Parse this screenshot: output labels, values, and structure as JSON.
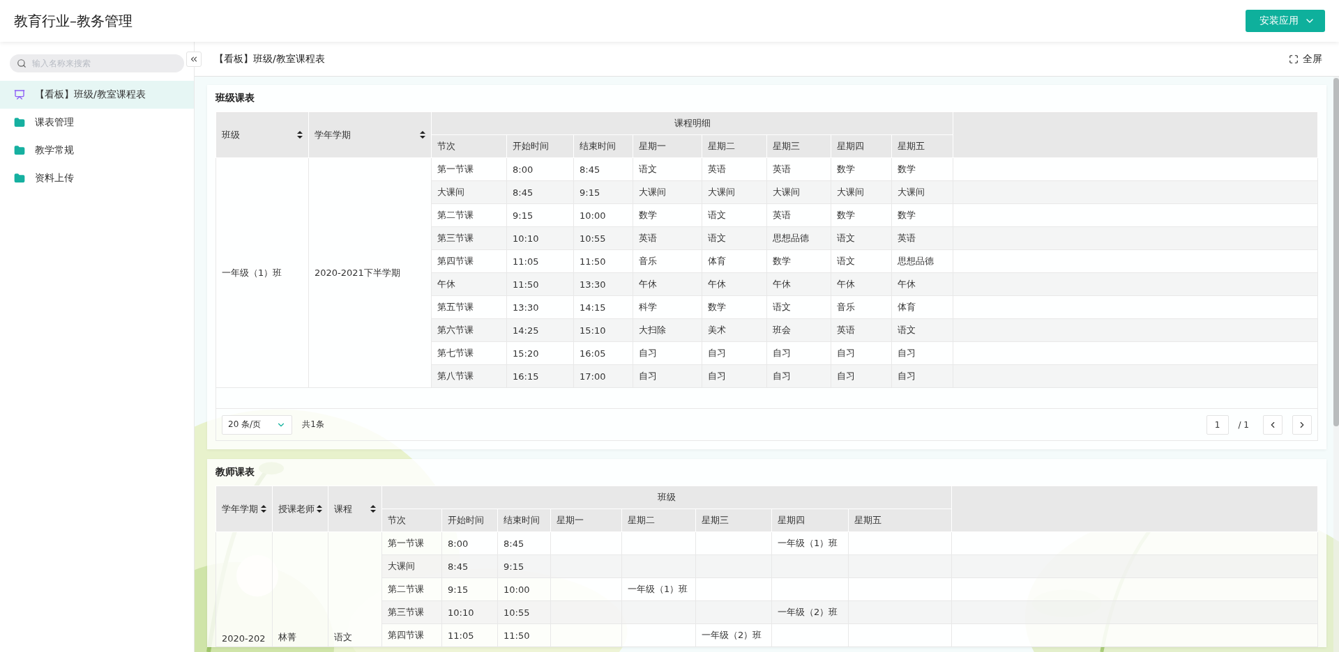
{
  "header": {
    "title": "教育行业–教务管理",
    "install_button": "安装应用"
  },
  "sidebar": {
    "search_placeholder": "输入名称来搜索",
    "items": [
      {
        "label": "【看板】班级/教室课程表",
        "kind": "board",
        "selected": true
      },
      {
        "label": "课表管理",
        "kind": "folder",
        "selected": false
      },
      {
        "label": "教学常规",
        "kind": "folder",
        "selected": false
      },
      {
        "label": "资料上传",
        "kind": "folder",
        "selected": false
      }
    ]
  },
  "breadcrumb": {
    "title": "【看板】班级/教室课程表",
    "fullscreen_button": "全屏"
  },
  "class_schedule": {
    "title": "班级课表",
    "lead_columns": [
      "班级",
      "学年学期"
    ],
    "group_title": "课程明细",
    "sub_columns": [
      "节次",
      "开始时间",
      "结束时间",
      "星期一",
      "星期二",
      "星期三",
      "星期四",
      "星期五"
    ],
    "lead_values": [
      "一年级（1）班",
      "2020-2021下半学期"
    ],
    "rows": [
      [
        "第一节课",
        "8:00",
        "8:45",
        "语文",
        "英语",
        "英语",
        "数学",
        "数学"
      ],
      [
        "大课间",
        "8:45",
        "9:15",
        "大课间",
        "大课间",
        "大课间",
        "大课间",
        "大课间"
      ],
      [
        "第二节课",
        "9:15",
        "10:00",
        "数学",
        "语文",
        "英语",
        "数学",
        "数学"
      ],
      [
        "第三节课",
        "10:10",
        "10:55",
        "英语",
        "语文",
        "思想品德",
        "语文",
        "英语"
      ],
      [
        "第四节课",
        "11:05",
        "11:50",
        "音乐",
        "体育",
        "数学",
        "语文",
        "思想品德"
      ],
      [
        "午休",
        "11:50",
        "13:30",
        "午休",
        "午休",
        "午休",
        "午休",
        "午休"
      ],
      [
        "第五节课",
        "13:30",
        "14:15",
        "科学",
        "数学",
        "语文",
        "音乐",
        "体育"
      ],
      [
        "第六节课",
        "14:25",
        "15:10",
        "大扫除",
        "美术",
        "班会",
        "英语",
        "语文"
      ],
      [
        "第七节课",
        "15:20",
        "16:05",
        "自习",
        "自习",
        "自习",
        "自习",
        "自习"
      ],
      [
        "第八节课",
        "16:15",
        "17:00",
        "自习",
        "自习",
        "自习",
        "自习",
        "自习"
      ]
    ],
    "pagination": {
      "page_size": "20 条/页",
      "total": "共1条",
      "page": "1",
      "pages": "/ 1"
    }
  },
  "teacher_schedule": {
    "title": "教师课表",
    "lead_columns": [
      "学年学期",
      "授课老师",
      "课程"
    ],
    "group_title": "班级",
    "sub_columns": [
      "节次",
      "开始时间",
      "结束时间",
      "星期一",
      "星期二",
      "星期三",
      "星期四",
      "星期五"
    ],
    "lead_values": [
      "2020-202",
      "林菁",
      "语文"
    ],
    "rows": [
      [
        "第一节课",
        "8:00",
        "8:45",
        "",
        "",
        "",
        "一年级（1）班",
        ""
      ],
      [
        "大课间",
        "8:45",
        "9:15",
        "",
        "",
        "",
        "",
        ""
      ],
      [
        "第二节课",
        "9:15",
        "10:00",
        "",
        "一年级（1）班",
        "",
        "",
        ""
      ],
      [
        "第三节课",
        "10:10",
        "10:55",
        "",
        "",
        "",
        "一年级（2）班",
        ""
      ],
      [
        "第四节课",
        "11:05",
        "11:50",
        "",
        "",
        "一年级（2）班",
        "",
        ""
      ]
    ]
  }
}
